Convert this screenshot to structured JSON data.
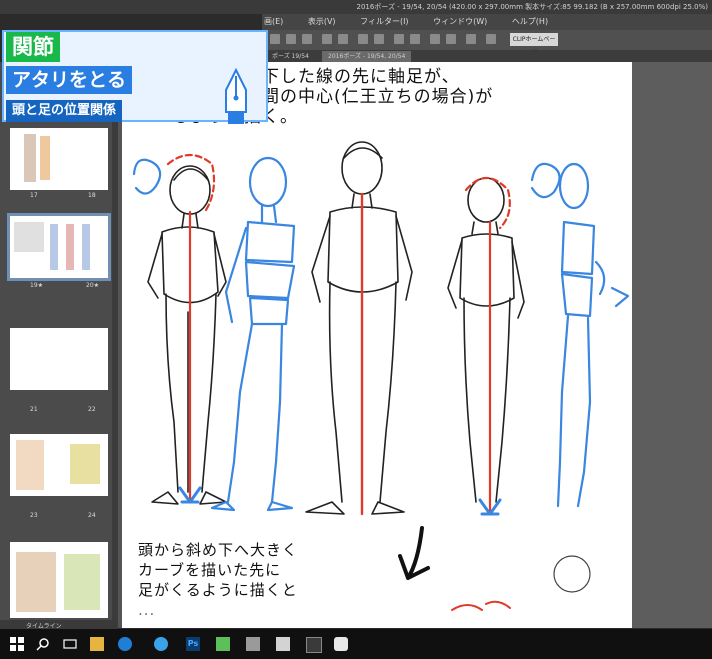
{
  "window": {
    "title": "2016ポーズ - 19/54, 20/54 (420.00 x 297.00mm 製本サイズ:85 99.182 (B x 257.00mm 600dpi 25.0%)"
  },
  "menubar": {
    "items": [
      "画(E)",
      "表示(V)",
      "フィルター(I)",
      "ウィンドウ(W)",
      "ヘルプ(H)"
    ]
  },
  "toolbar": {
    "clip_button_label": "CLIPホームページ"
  },
  "tabs": [
    "ポーズ 19/54",
    "2016ポーズ - 19/54, 20/54"
  ],
  "sidebar": {
    "thumbnails": [
      {
        "labels": [
          "17",
          "18"
        ]
      },
      {
        "labels": [
          "19★",
          "20★"
        ]
      },
      {
        "labels": [
          "21",
          "22"
        ]
      },
      {
        "labels": [
          "23",
          "24"
        ]
      },
      {
        "labels": [
          "",
          ""
        ]
      }
    ],
    "bottom_label": "タイムライン"
  },
  "overlay": {
    "title_line1": "関節",
    "title_line2": "アタリをとる",
    "subtitle": "頭と足の位置関係"
  },
  "page": {
    "top_text": [
      "から垂直に下した線の先に軸足が、",
      "左右の足の間の中心(仁王立ちの場合)が",
      "るように描く。"
    ],
    "bottom_text": [
      "頭から斜め下へ大きく",
      "カーブを描いた先に",
      "足がくるように描くと",
      "..."
    ]
  },
  "colors": {
    "overlay_green": "#19b84a",
    "overlay_blue": "#2a7de1",
    "overlay_navy": "#1565c0",
    "sketch_blue": "#3a86e0",
    "guide_red": "#e03a2a"
  },
  "taskbar": {
    "icons": [
      "windows-icon",
      "search-icon",
      "task-view-icon",
      "file-explorer-icon",
      "edge-icon",
      "ie-icon",
      "photoshop-icon",
      "app-icon",
      "app-icon",
      "app-icon",
      "app-icon",
      "clip-studio-icon"
    ]
  }
}
